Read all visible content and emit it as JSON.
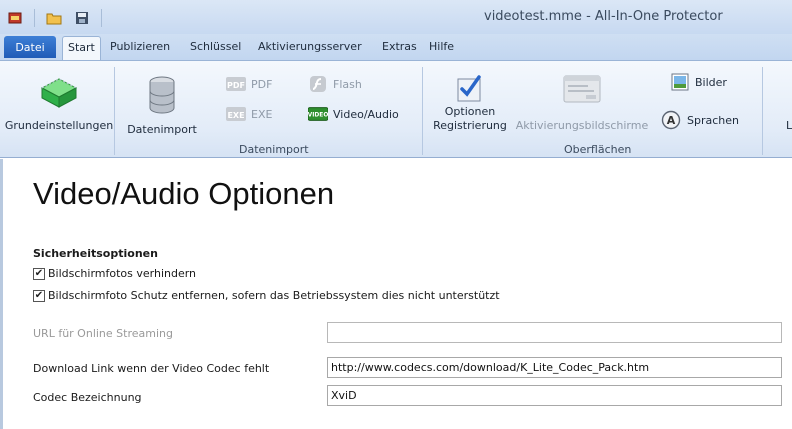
{
  "window": {
    "title": "videotest.mme  - All-In-One Protector"
  },
  "quick_access": {
    "icons": [
      "app-icon",
      "open-folder-icon",
      "save-icon"
    ]
  },
  "tabs": {
    "file": "Datei",
    "items": [
      "Start",
      "Publizieren",
      "Schlüssel",
      "Aktivierungsserver",
      "Extras",
      "Hilfe"
    ],
    "active": "Start"
  },
  "ribbon": {
    "grundeinstellungen": "Grundeinstellungen",
    "datenimport_btn": "Datenimport",
    "pdf": "PDF",
    "exe": "EXE",
    "flash": "Flash",
    "video_audio": "Video/Audio",
    "group_datenimport": "Datenimport",
    "optionen": "Optionen",
    "registrierung": "Registrierung",
    "aktivierungsbildschirme": "Aktivierungsbildschirme",
    "bilder": "Bilder",
    "sprachen": "Sprachen",
    "group_oberflaechen": "Oberflächen",
    "partial": "L"
  },
  "content": {
    "title": "Video/Audio Optionen",
    "section": "Sicherheitsoptionen",
    "checkbox1": {
      "label": "Bildschirmfotos verhindern",
      "checked": true
    },
    "checkbox2": {
      "label": "Bildschirmfoto Schutz entfernen, sofern das Betriebssystem dies nicht unterstützt",
      "checked": true
    },
    "url_label": "URL für Online Streaming",
    "url_value": "",
    "download_label": "Download Link wenn der Video Codec fehlt",
    "download_value": "http://www.codecs.com/download/K_Lite_Codec_Pack.htm",
    "codec_label": "Codec Bezeichnung",
    "codec_value": "XviD"
  },
  "colors": {
    "accent": "#1f5bb7",
    "ribbon_bg": "#e3ecf8"
  }
}
